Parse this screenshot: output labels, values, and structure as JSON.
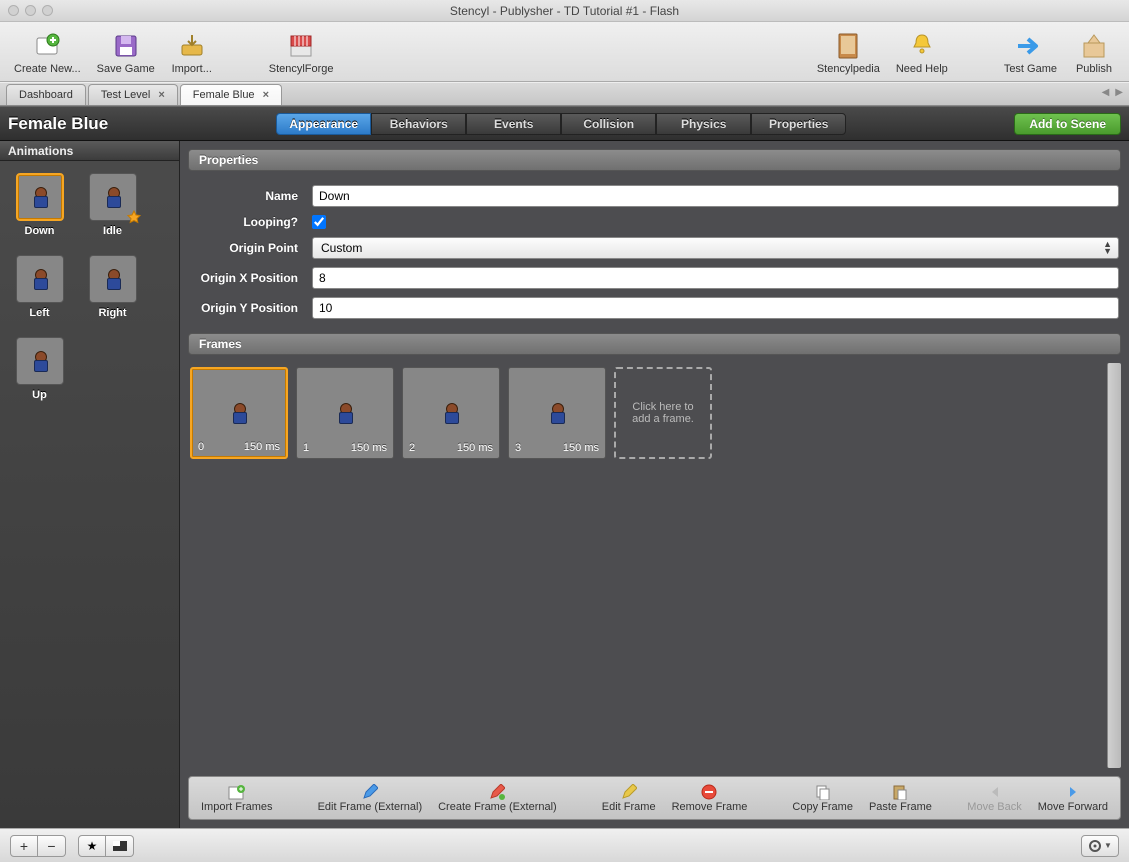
{
  "window": {
    "title": "Stencyl - Publysher - TD Tutorial #1 - Flash"
  },
  "toolbar": {
    "createNew": "Create New...",
    "saveGame": "Save Game",
    "import": "Import...",
    "stencylForge": "StencylForge",
    "stencylpedia": "Stencylpedia",
    "needHelp": "Need Help",
    "testGame": "Test Game",
    "publish": "Publish"
  },
  "tabs": {
    "dashboard": "Dashboard",
    "testLevel": "Test Level",
    "femaleBlue": "Female Blue"
  },
  "subbar": {
    "title": "Female Blue",
    "appearance": "Appearance",
    "behaviors": "Behaviors",
    "events": "Events",
    "collision": "Collision",
    "physics": "Physics",
    "properties": "Properties",
    "addToScene": "Add to Scene"
  },
  "sidebar": {
    "header": "Animations",
    "items": [
      {
        "name": "Down"
      },
      {
        "name": "Idle"
      },
      {
        "name": "Left"
      },
      {
        "name": "Right"
      },
      {
        "name": "Up"
      }
    ]
  },
  "properties": {
    "header": "Properties",
    "nameLabel": "Name",
    "nameValue": "Down",
    "loopingLabel": "Looping?",
    "loopingChecked": true,
    "originPointLabel": "Origin Point",
    "originPointValue": "Custom",
    "originXLabel": "Origin X Position",
    "originXValue": "8",
    "originYLabel": "Origin Y Position",
    "originYValue": "10"
  },
  "frames": {
    "header": "Frames",
    "items": [
      {
        "index": "0",
        "duration": "150 ms"
      },
      {
        "index": "1",
        "duration": "150 ms"
      },
      {
        "index": "2",
        "duration": "150 ms"
      },
      {
        "index": "3",
        "duration": "150 ms"
      }
    ],
    "addText": "Click here to add a frame."
  },
  "framesToolbar": {
    "importFrames": "Import Frames",
    "editFrameExternal": "Edit Frame (External)",
    "createFrameExternal": "Create Frame (External)",
    "editFrame": "Edit Frame",
    "removeFrame": "Remove Frame",
    "copyFrame": "Copy Frame",
    "pasteFrame": "Paste Frame",
    "moveBack": "Move Back",
    "moveForward": "Move Forward"
  }
}
